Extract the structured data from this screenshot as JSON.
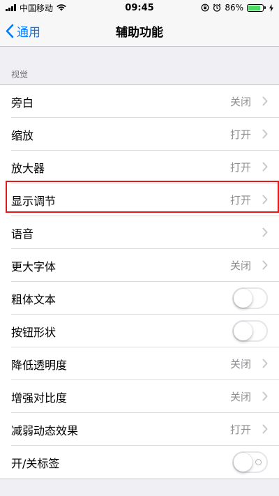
{
  "status_bar": {
    "carrier": "中国移动",
    "time": "09:45",
    "battery": "86%",
    "battery_level": 0.86
  },
  "nav": {
    "back_label": "通用",
    "title": "辅助功能"
  },
  "section": {
    "header": "视觉"
  },
  "rows": [
    {
      "label": "旁白",
      "value": "关闭"
    },
    {
      "label": "缩放",
      "value": "打开"
    },
    {
      "label": "放大器",
      "value": "打开"
    },
    {
      "label": "显示调节",
      "value": "打开"
    },
    {
      "label": "语音",
      "value": ""
    },
    {
      "label": "更大字体",
      "value": "关闭"
    },
    {
      "label": "粗体文本",
      "toggle": false
    },
    {
      "label": "按钮形状",
      "toggle": false
    },
    {
      "label": "降低透明度",
      "value": "关闭"
    },
    {
      "label": "增强对比度",
      "value": "关闭"
    },
    {
      "label": "减弱动态效果",
      "value": "打开"
    },
    {
      "label": "开/关标签",
      "toggle": false
    }
  ],
  "colors": {
    "accent": "#007aff",
    "highlight": "#e0191b",
    "battery": "#4cd964"
  }
}
